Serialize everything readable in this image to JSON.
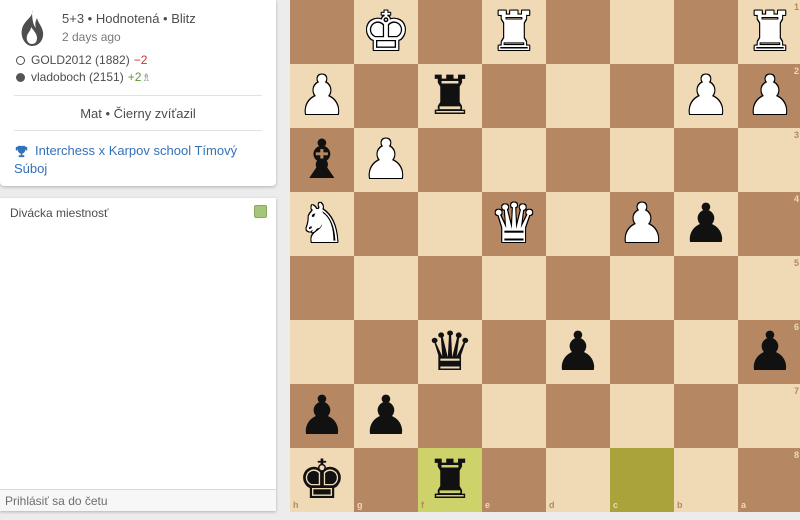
{
  "game": {
    "type": "5+3 • Hodnotená • Blitz",
    "date": "2 days ago",
    "white_player": {
      "name": "GOLD2012 (1882)",
      "rating_diff": "−2"
    },
    "black_player": {
      "name": "vladoboch (2151)",
      "rating_diff": "+2",
      "icon": "provisional-icon"
    },
    "result": "Mat • Čierny zvíťazil",
    "tournament": "Interchess x Karpov school Tímový Súboj",
    "icons": {
      "speed": "flame-icon",
      "tournament": "trophy-icon"
    }
  },
  "chat": {
    "title": "Divácka miestnosť",
    "placeholder": "Prihlásiť sa do četu"
  },
  "board": {
    "orientation": "black",
    "files_display": [
      "h",
      "g",
      "f",
      "e",
      "d",
      "c",
      "b",
      "a"
    ],
    "ranks_display": [
      "1",
      "2",
      "3",
      "4",
      "5",
      "6",
      "7",
      "8"
    ],
    "colors": {
      "light": "#f0d9b5",
      "dark": "#b58863",
      "highlight_light": "#cdd26a",
      "highlight_dark": "#aaa23a"
    },
    "last_move": [
      "f8",
      "c8"
    ],
    "pieces": [
      {
        "sq": "g1",
        "color": "w",
        "type": "K",
        "glyph": "♚"
      },
      {
        "sq": "e1",
        "color": "w",
        "type": "R",
        "glyph": "♜"
      },
      {
        "sq": "a1",
        "color": "w",
        "type": "R",
        "glyph": "♜"
      },
      {
        "sq": "h2",
        "color": "w",
        "type": "P",
        "glyph": "♟"
      },
      {
        "sq": "f2",
        "color": "b",
        "type": "R",
        "glyph": "♜"
      },
      {
        "sq": "b2",
        "color": "w",
        "type": "P",
        "glyph": "♟"
      },
      {
        "sq": "a2",
        "color": "w",
        "type": "P",
        "glyph": "♟"
      },
      {
        "sq": "h3",
        "color": "b",
        "type": "B",
        "glyph": "♝"
      },
      {
        "sq": "g3",
        "color": "w",
        "type": "P",
        "glyph": "♟"
      },
      {
        "sq": "h4",
        "color": "w",
        "type": "N",
        "glyph": "♞"
      },
      {
        "sq": "e4",
        "color": "w",
        "type": "Q",
        "glyph": "♛"
      },
      {
        "sq": "c4",
        "color": "w",
        "type": "P",
        "glyph": "♟"
      },
      {
        "sq": "b4",
        "color": "b",
        "type": "P",
        "glyph": "♟"
      },
      {
        "sq": "f6",
        "color": "b",
        "type": "Q",
        "glyph": "♛"
      },
      {
        "sq": "d6",
        "color": "b",
        "type": "P",
        "glyph": "♟"
      },
      {
        "sq": "a6",
        "color": "b",
        "type": "P",
        "glyph": "♟"
      },
      {
        "sq": "h7",
        "color": "b",
        "type": "P",
        "glyph": "♟"
      },
      {
        "sq": "g7",
        "color": "b",
        "type": "P",
        "glyph": "♟"
      },
      {
        "sq": "h8",
        "color": "b",
        "type": "K",
        "glyph": "♚"
      },
      {
        "sq": "f8",
        "color": "b",
        "type": "R",
        "glyph": "♜"
      }
    ]
  }
}
